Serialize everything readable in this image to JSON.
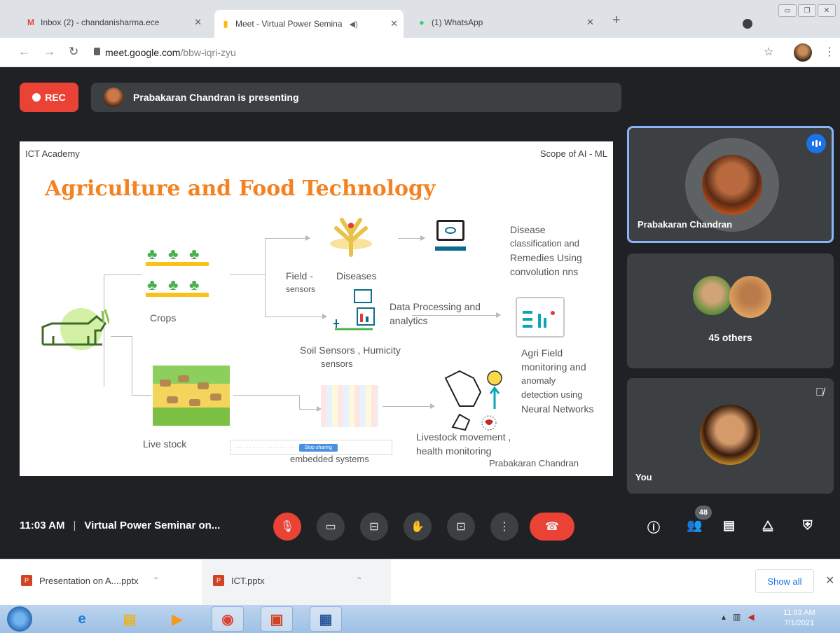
{
  "browser": {
    "tabs": [
      {
        "title": "Inbox (2) - chandanisharma.ece",
        "favicon": "gmail-icon",
        "active": false
      },
      {
        "title": "Meet - Virtual Power Semina",
        "favicon": "meet-icon",
        "active": true
      },
      {
        "title": "(1) WhatsApp",
        "favicon": "whatsapp-icon",
        "active": false
      }
    ],
    "close_glyph": "✕",
    "newtab_glyph": "+",
    "url_host": "meet.google.com",
    "url_path": "/bbw-iqri-zyu"
  },
  "meet": {
    "rec_label": "REC",
    "presenting_text": "Prabakaran Chandran is presenting",
    "slide": {
      "header_left": "ICT Academy",
      "header_right": "Scope of AI - ML",
      "title": "Agriculture and Food Technology",
      "labels": {
        "crops": "Crops",
        "field_sensors_1": "Field -",
        "field_sensors_2": "sensors",
        "diseases": "Diseases",
        "disease_class_1": "Disease",
        "disease_class_2": "classification and",
        "disease_class_3": "Remedies Using",
        "disease_class_4": "convolution nns",
        "data_processing_1": "Data Processing and",
        "data_processing_2": "analytics",
        "soil_sensors_1": "Soil Sensors , Humicity",
        "soil_sensors_2": "sensors",
        "agri_field_1": "Agri Field",
        "agri_field_2": "monitoring and",
        "agri_field_3": "anomaly",
        "agri_field_4": "detection  using",
        "agri_field_5": "Neural Networks",
        "livestock": "Live stock",
        "embedded": "embedded systems",
        "livestock_move_1": "Livestock movement ,",
        "livestock_move_2": "health monitoring",
        "author": "Prabakaran Chandran"
      },
      "share_bar_button": "Stop sharing"
    },
    "tiles": [
      {
        "name": "Prabakaran Chandran"
      },
      {
        "others": "45 others"
      },
      {
        "name": "You"
      }
    ],
    "bottom": {
      "time": "11:03 AM",
      "separator": "|",
      "meeting_title": "Virtual Power Seminar on...",
      "participants_count": "48"
    }
  },
  "downloads": {
    "items": [
      {
        "name": "Presentation on A....pptx"
      },
      {
        "name": "ICT.pptx"
      }
    ],
    "show_all": "Show all"
  },
  "taskbar": {
    "clock_time": "11:03 AM",
    "clock_date": "7/1/2021"
  },
  "colors": {
    "accent_red": "#ea4335",
    "title_orange": "#f58220",
    "active_border": "#8ab4f8"
  }
}
